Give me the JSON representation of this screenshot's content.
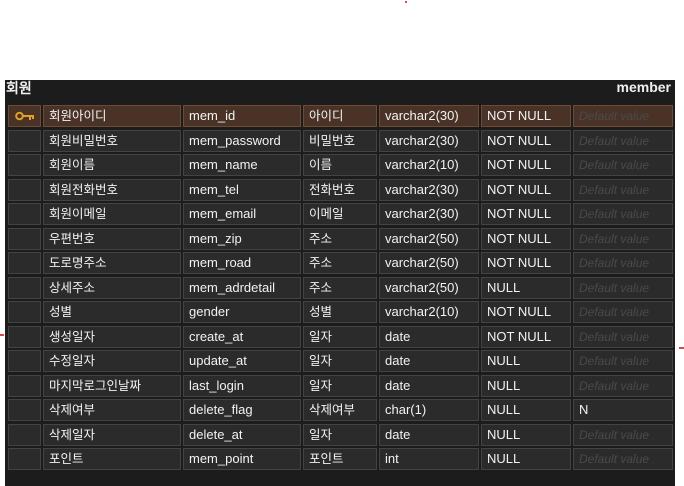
{
  "entity": {
    "logical_name": "회원",
    "physical_name": "member",
    "default_placeholder": "Default value",
    "key_color": "#e0a12a",
    "columns": [
      {
        "logical": "회원아이디",
        "physical": "mem_id",
        "domain": "아이디",
        "type": "varchar2(30)",
        "nullable": "NOT NULL",
        "default": "",
        "pk": true
      },
      {
        "logical": "회원비밀번호",
        "physical": "mem_password",
        "domain": "비밀번호",
        "type": "varchar2(30)",
        "nullable": "NOT NULL",
        "default": "",
        "pk": false
      },
      {
        "logical": "회원이름",
        "physical": "mem_name",
        "domain": "이름",
        "type": "varchar2(10)",
        "nullable": "NOT NULL",
        "default": "",
        "pk": false
      },
      {
        "logical": "회원전화번호",
        "physical": "mem_tel",
        "domain": "전화번호",
        "type": "varchar2(30)",
        "nullable": "NOT NULL",
        "default": "",
        "pk": false
      },
      {
        "logical": "회원이메일",
        "physical": "mem_email",
        "domain": "이메일",
        "type": "varchar2(30)",
        "nullable": "NOT NULL",
        "default": "",
        "pk": false
      },
      {
        "logical": "우편번호",
        "physical": "mem_zip",
        "domain": "주소",
        "type": "varchar2(50)",
        "nullable": "NOT NULL",
        "default": "",
        "pk": false
      },
      {
        "logical": "도로명주소",
        "physical": "mem_road",
        "domain": "주소",
        "type": "varchar2(50)",
        "nullable": "NOT NULL",
        "default": "",
        "pk": false
      },
      {
        "logical": "상세주소",
        "physical": "mem_adrdetail",
        "domain": "주소",
        "type": "varchar2(50)",
        "nullable": "NULL",
        "default": "",
        "pk": false
      },
      {
        "logical": "성별",
        "physical": "gender",
        "domain": "성별",
        "type": "varchar2(10)",
        "nullable": "NOT NULL",
        "default": "",
        "pk": false
      },
      {
        "logical": "생성일자",
        "physical": "create_at",
        "domain": "일자",
        "type": "date",
        "nullable": "NOT NULL",
        "default": "",
        "pk": false
      },
      {
        "logical": "수정일자",
        "physical": "update_at",
        "domain": "일자",
        "type": "date",
        "nullable": "NULL",
        "default": "",
        "pk": false
      },
      {
        "logical": "마지막로그인날짜",
        "physical": "last_login",
        "domain": "일자",
        "type": "date",
        "nullable": "NULL",
        "default": "",
        "pk": false
      },
      {
        "logical": "삭제여부",
        "physical": "delete_flag",
        "domain": "삭제여부",
        "type": "char(1)",
        "nullable": "NULL",
        "default": "N",
        "pk": false
      },
      {
        "logical": "삭제일자",
        "physical": "delete_at",
        "domain": "일자",
        "type": "date",
        "nullable": "NULL",
        "default": "",
        "pk": false
      },
      {
        "logical": "포인트",
        "physical": "mem_point",
        "domain": "포인트",
        "type": "int",
        "nullable": "NULL",
        "default": "",
        "pk": false
      }
    ]
  }
}
